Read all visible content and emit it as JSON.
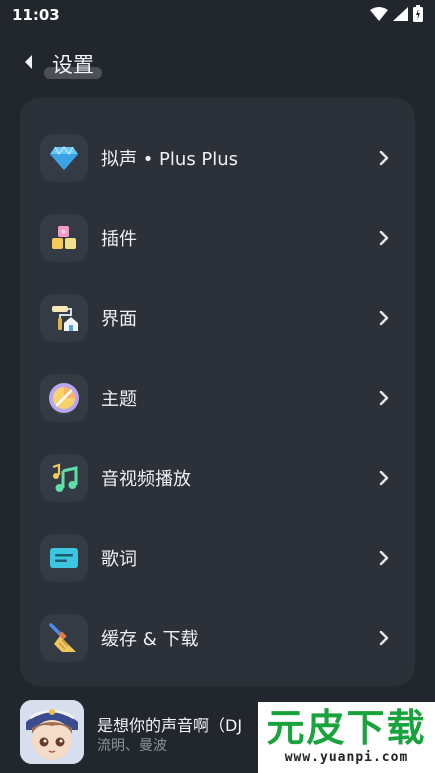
{
  "status_bar": {
    "time": "11:03"
  },
  "header": {
    "title": "设置"
  },
  "menu": [
    {
      "label": "拟声 • Plus Plus",
      "icon": "diamond-icon"
    },
    {
      "label": "插件",
      "icon": "blocks-icon"
    },
    {
      "label": "界面",
      "icon": "paint-roller-icon"
    },
    {
      "label": "主题",
      "icon": "theme-disc-icon"
    },
    {
      "label": "音视频播放",
      "icon": "music-note-icon"
    },
    {
      "label": "歌词",
      "icon": "lyrics-card-icon"
    },
    {
      "label": "缓存 & 下载",
      "icon": "broom-icon"
    }
  ],
  "player": {
    "title": "是想你的声音啊（DJ",
    "artist": "流明、曼波"
  },
  "watermark": {
    "main": "元皮下载",
    "url": "www.yuanpi.com"
  },
  "colors": {
    "background": "#22262d",
    "card": "#2c3139",
    "icon_box": "#353b44",
    "watermark_green": "#19a33c"
  }
}
